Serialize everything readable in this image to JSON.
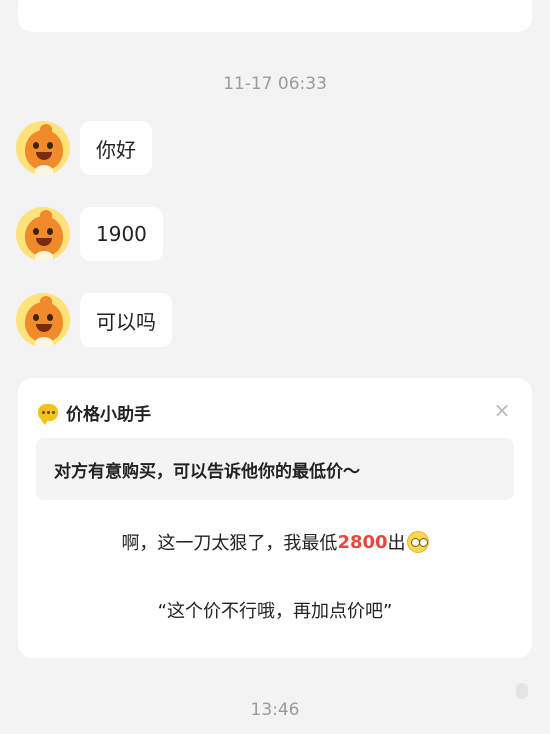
{
  "timestamps": {
    "first": "11-17 06:33",
    "second": "13:46"
  },
  "messages": [
    {
      "text": "你好",
      "avatar": "mascot-avatar-icon"
    },
    {
      "text": "1900",
      "avatar": "mascot-avatar-icon"
    },
    {
      "text": "可以吗",
      "avatar": "mascot-avatar-icon"
    }
  ],
  "assistant": {
    "icon": "chat-bubble-icon",
    "title": "价格小助手",
    "close": "×",
    "prompt": "对方有意购买，可以告诉他你的最低价～",
    "reply_1": {
      "prefix": "啊，这一刀太狠了，我最低",
      "price": "2800",
      "suffix": "出",
      "emoji": "dizzy-face-icon"
    },
    "reply_2": "“这个价不行哦，再加点价吧”"
  },
  "colors": {
    "background": "#f3f3f3",
    "price": "#e8473f",
    "icon_yellow": "#f3c21a",
    "avatar_orange": "#f08a2a"
  }
}
